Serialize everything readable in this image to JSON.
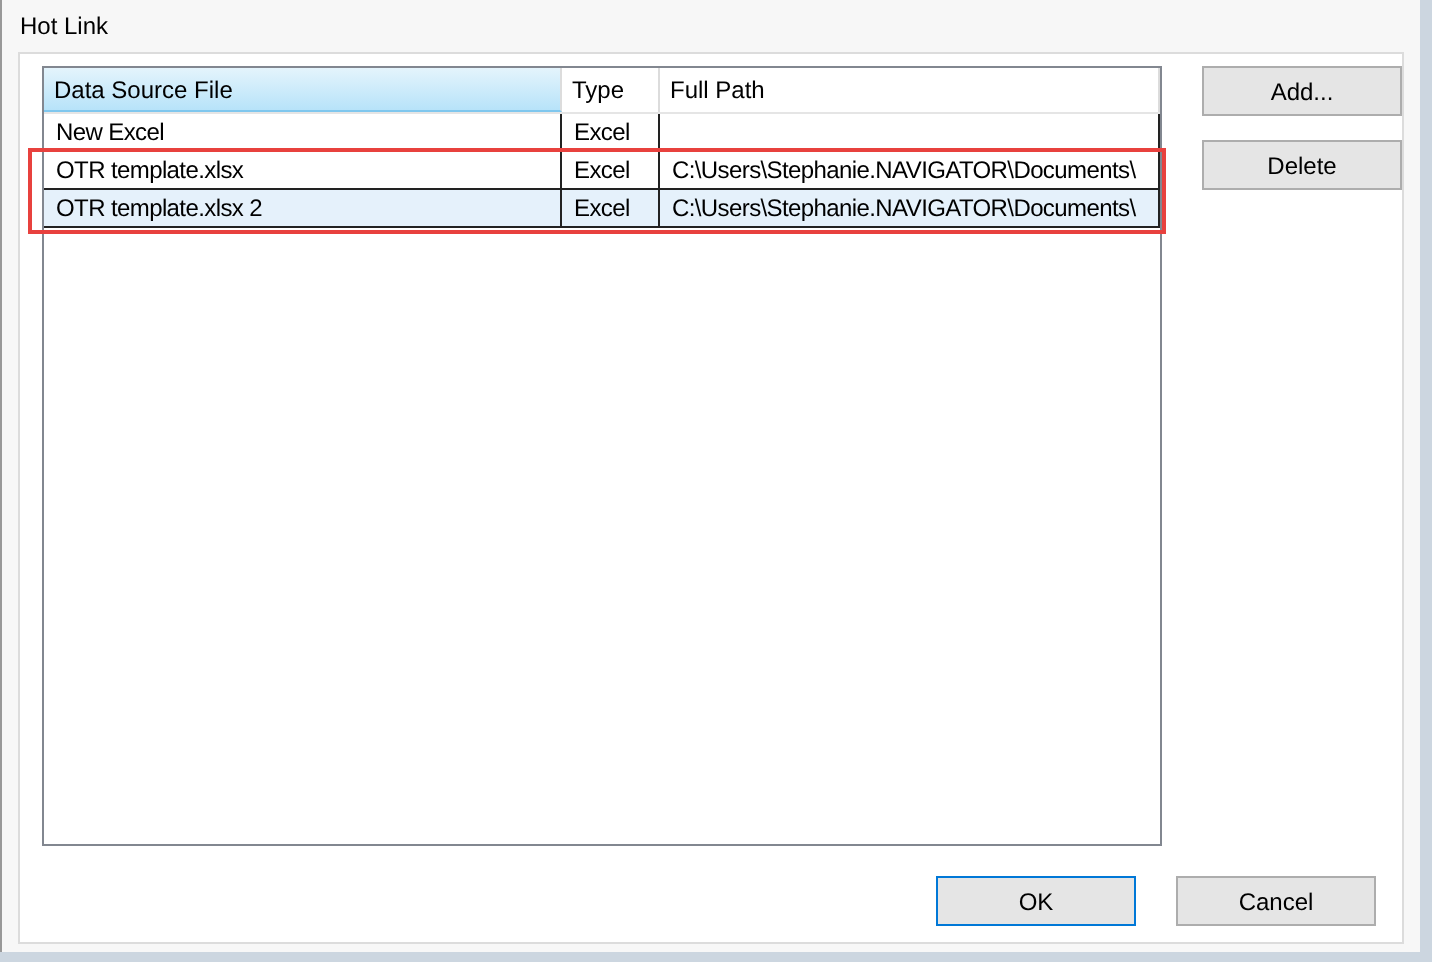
{
  "window": {
    "title": "Hot Link"
  },
  "table": {
    "columns": [
      {
        "label": "Data Source File",
        "selected": true
      },
      {
        "label": "Type",
        "selected": false
      },
      {
        "label": "Full Path",
        "selected": false
      }
    ],
    "rows": [
      {
        "cells": [
          "New Excel",
          "Excel",
          ""
        ],
        "selected": false,
        "highlighted": false
      },
      {
        "cells": [
          "OTR template.xlsx",
          "Excel",
          "C:\\Users\\Stephanie.NAVIGATOR\\Documents\\"
        ],
        "selected": false,
        "highlighted": true
      },
      {
        "cells": [
          "OTR template.xlsx 2",
          "Excel",
          "C:\\Users\\Stephanie.NAVIGATOR\\Documents\\"
        ],
        "selected": true,
        "highlighted": true
      }
    ]
  },
  "side_buttons": [
    "Add...",
    "Delete"
  ],
  "buttons": [
    {
      "label": "OK",
      "default": true
    },
    {
      "label": "Cancel",
      "default": false
    }
  ]
}
